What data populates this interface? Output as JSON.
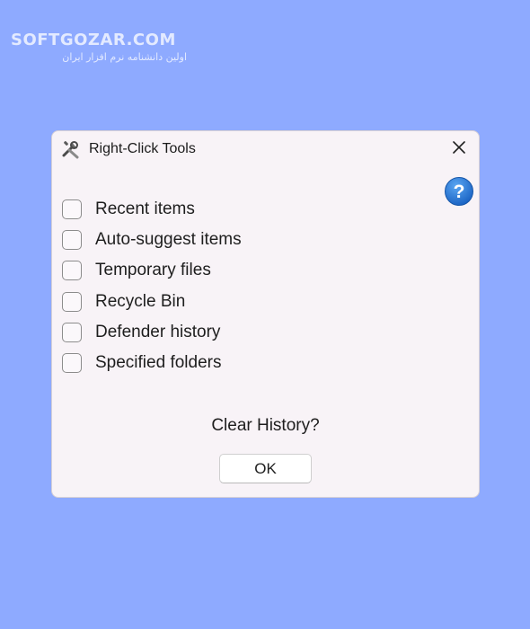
{
  "watermark": {
    "title": "SOFTGOZAR.COM",
    "subtitle": "اولین دانشنامه نرم افزار ایران"
  },
  "dialog": {
    "title": "Right-Click Tools",
    "app_icon": "tools-icon",
    "close_icon": "close-icon",
    "help_icon": "help-icon",
    "items": [
      {
        "label": "Recent items",
        "checked": false
      },
      {
        "label": "Auto-suggest items",
        "checked": false
      },
      {
        "label": "Temporary files",
        "checked": false
      },
      {
        "label": "Recycle Bin",
        "checked": false
      },
      {
        "label": "Defender history",
        "checked": false
      },
      {
        "label": "Specified folders",
        "checked": false
      }
    ],
    "question": "Clear History?",
    "ok_label": "OK"
  },
  "colors": {
    "background": "#8eaaff",
    "dialog_background": "#f8f3f7",
    "help_blue": "#1e73d2"
  }
}
